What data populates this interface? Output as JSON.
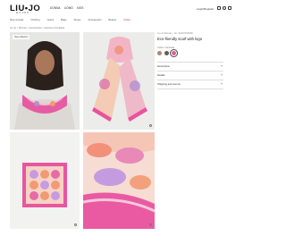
{
  "header": {
    "logo": "LIU•JO",
    "logo_sub": "MILANO",
    "topnav": [
      "DONNA",
      "UOMO",
      "KIDS"
    ],
    "login": "Login/Register",
    "icons": [
      "user-icon",
      "heart-icon",
      "bag-icon"
    ]
  },
  "categories": [
    {
      "label": "New arrivals"
    },
    {
      "label": "Clothing"
    },
    {
      "label": "Jeans"
    },
    {
      "label": "Bags"
    },
    {
      "label": "Shoes"
    },
    {
      "label": "Accessories"
    },
    {
      "label": "Beauty"
    },
    {
      "label": "Outlet",
      "sale": true
    }
  ],
  "breadcrumb": "Liu Jo  >  Woman  >  Accessories  >  Scarves & Foulards",
  "gallery": {
    "badge": "New collection"
  },
  "product": {
    "pretitle": "Liu Jo Woman  ·  Art. 2A4070T0300",
    "title": "Eco-friendly scarf with logo",
    "color_label": "Colour: Fantasia",
    "swatches": [
      {
        "color": "#a58d6e",
        "selected": false
      },
      {
        "color": "#6b5a4e",
        "selected": false
      },
      {
        "color": "#e05f95",
        "selected": true
      }
    ],
    "accordions": [
      "Description",
      "Details",
      "Shipping and returns"
    ]
  },
  "colors": {
    "accent": "#c03050",
    "pink": "#e85fa0"
  }
}
